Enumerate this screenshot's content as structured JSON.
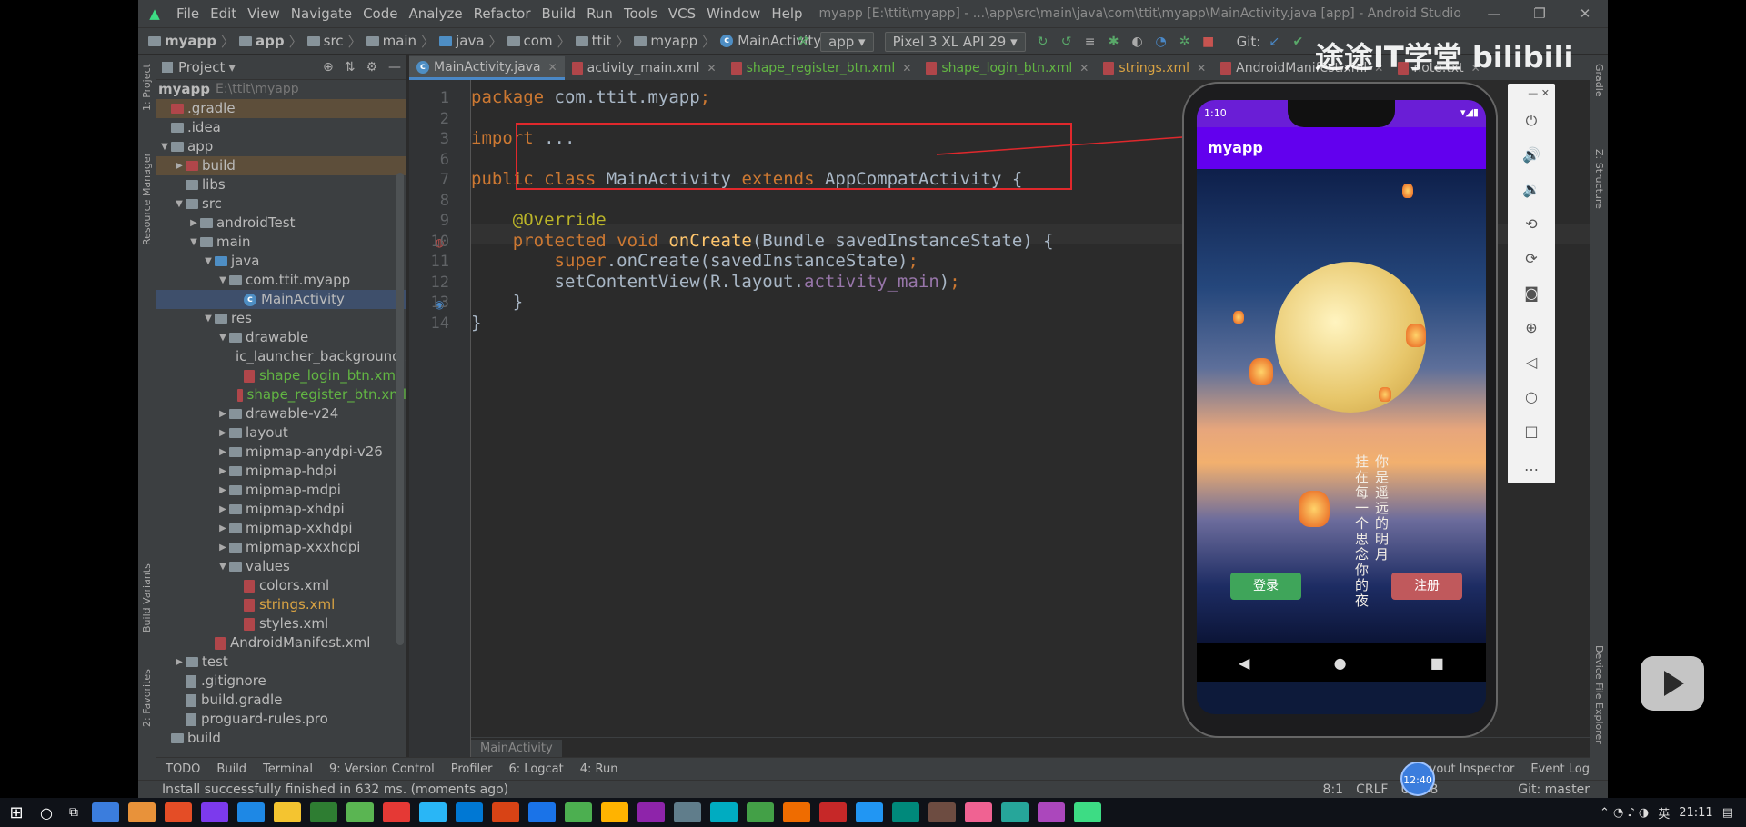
{
  "window": {
    "title": "myapp [E:\\ttit\\myapp] - ...\\app\\src\\main\\java\\com\\ttit\\myapp\\MainActivity.java [app] - Android Studio",
    "menu": [
      "File",
      "Edit",
      "View",
      "Navigate",
      "Code",
      "Analyze",
      "Refactor",
      "Build",
      "Run",
      "Tools",
      "VCS",
      "Window",
      "Help"
    ]
  },
  "breadcrumb": [
    "myapp",
    "app",
    "src",
    "main",
    "java",
    "com",
    "ttit",
    "myapp",
    "MainActivity"
  ],
  "toolbar": {
    "run_config": "app",
    "device": "Pixel 3 XL API 29",
    "git_label": "Git:"
  },
  "project_panel": {
    "header": "Project",
    "root": "myapp",
    "root_path": "E:\\ttit\\myapp",
    "items": [
      {
        "label": ".gradle",
        "indent": 0,
        "type": "folder",
        "state": "excluded"
      },
      {
        "label": ".idea",
        "indent": 0,
        "type": "folder"
      },
      {
        "label": "app",
        "indent": 0,
        "type": "folder",
        "arrow": "open"
      },
      {
        "label": "build",
        "indent": 1,
        "type": "folder",
        "arrow": "closed",
        "state": "excluded"
      },
      {
        "label": "libs",
        "indent": 1,
        "type": "folder"
      },
      {
        "label": "src",
        "indent": 1,
        "type": "folder",
        "arrow": "open"
      },
      {
        "label": "androidTest",
        "indent": 2,
        "type": "folder",
        "arrow": "closed"
      },
      {
        "label": "main",
        "indent": 2,
        "type": "folder",
        "arrow": "open"
      },
      {
        "label": "java",
        "indent": 3,
        "type": "folder-blue",
        "arrow": "open"
      },
      {
        "label": "com.ttit.myapp",
        "indent": 4,
        "type": "folder",
        "arrow": "open"
      },
      {
        "label": "MainActivity",
        "indent": 5,
        "type": "class",
        "state": "selected"
      },
      {
        "label": "res",
        "indent": 3,
        "type": "folder",
        "arrow": "open"
      },
      {
        "label": "drawable",
        "indent": 4,
        "type": "folder",
        "arrow": "open"
      },
      {
        "label": "ic_launcher_background.x",
        "indent": 5,
        "type": "xml"
      },
      {
        "label": "shape_login_btn.xml",
        "indent": 5,
        "type": "xml",
        "color": "#62b543"
      },
      {
        "label": "shape_register_btn.xml",
        "indent": 5,
        "type": "xml",
        "color": "#62b543"
      },
      {
        "label": "drawable-v24",
        "indent": 4,
        "type": "folder",
        "arrow": "closed"
      },
      {
        "label": "layout",
        "indent": 4,
        "type": "folder",
        "arrow": "closed"
      },
      {
        "label": "mipmap-anydpi-v26",
        "indent": 4,
        "type": "folder",
        "arrow": "closed"
      },
      {
        "label": "mipmap-hdpi",
        "indent": 4,
        "type": "folder",
        "arrow": "closed"
      },
      {
        "label": "mipmap-mdpi",
        "indent": 4,
        "type": "folder",
        "arrow": "closed"
      },
      {
        "label": "mipmap-xhdpi",
        "indent": 4,
        "type": "folder",
        "arrow": "closed"
      },
      {
        "label": "mipmap-xxhdpi",
        "indent": 4,
        "type": "folder",
        "arrow": "closed"
      },
      {
        "label": "mipmap-xxxhdpi",
        "indent": 4,
        "type": "folder",
        "arrow": "closed"
      },
      {
        "label": "values",
        "indent": 4,
        "type": "folder",
        "arrow": "open"
      },
      {
        "label": "colors.xml",
        "indent": 5,
        "type": "xml"
      },
      {
        "label": "strings.xml",
        "indent": 5,
        "type": "xml",
        "color": "#d9a343"
      },
      {
        "label": "styles.xml",
        "indent": 5,
        "type": "xml"
      },
      {
        "label": "AndroidManifest.xml",
        "indent": 3,
        "type": "xml"
      },
      {
        "label": "test",
        "indent": 1,
        "type": "folder",
        "arrow": "closed"
      },
      {
        "label": ".gitignore",
        "indent": 1,
        "type": "file"
      },
      {
        "label": "build.gradle",
        "indent": 1,
        "type": "file"
      },
      {
        "label": "proguard-rules.pro",
        "indent": 1,
        "type": "file"
      },
      {
        "label": "build",
        "indent": 0,
        "type": "folder"
      }
    ]
  },
  "tabs": [
    {
      "label": "MainActivity.java",
      "active": true
    },
    {
      "label": "activity_main.xml"
    },
    {
      "label": "shape_register_btn.xml"
    },
    {
      "label": "shape_login_btn.xml"
    },
    {
      "label": "strings.xml"
    },
    {
      "label": "AndroidManifest.xml"
    },
    {
      "label": "note.txt"
    }
  ],
  "code": {
    "line_numbers": [
      "1",
      "2",
      "3",
      "6",
      "7",
      "8",
      "9",
      "10",
      "11",
      "12",
      "13",
      "14"
    ],
    "lines": [
      [
        {
          "t": "package ",
          "c": "kw"
        },
        {
          "t": "com.ttit.myapp",
          "c": "pl"
        },
        {
          "t": ";",
          "c": "kw"
        }
      ],
      [],
      [
        {
          "t": "import ",
          "c": "kw"
        },
        {
          "t": "...",
          "c": "pl"
        }
      ],
      [],
      [
        {
          "t": "public class ",
          "c": "kw"
        },
        {
          "t": "MainActivity ",
          "c": "pl"
        },
        {
          "t": "extends ",
          "c": "kw"
        },
        {
          "t": "AppCompatActivity ",
          "c": "pl"
        },
        {
          "t": "{",
          "c": "pl"
        }
      ],
      [],
      [
        {
          "t": "    @Override",
          "c": "ann"
        }
      ],
      [
        {
          "t": "    protected void ",
          "c": "kw"
        },
        {
          "t": "onCreate",
          "c": "fn"
        },
        {
          "t": "(Bundle savedInstanceState) {",
          "c": "pl"
        }
      ],
      [
        {
          "t": "        super",
          "c": "kw"
        },
        {
          "t": ".onCreate(savedInstanceState)",
          "c": "pl"
        },
        {
          "t": ";",
          "c": "kw"
        }
      ],
      [
        {
          "t": "        setContentView(R.layout.",
          "c": "pl"
        },
        {
          "t": "activity_main",
          "c": "field"
        },
        {
          "t": ")",
          "c": "pl"
        },
        {
          "t": ";",
          "c": "kw"
        }
      ],
      [
        {
          "t": "    }",
          "c": "pl"
        }
      ],
      [
        {
          "t": "}",
          "c": "pl"
        }
      ]
    ],
    "breadcrumb": "MainActivity"
  },
  "tool_windows": [
    "TODO",
    "Build",
    "Terminal",
    "9: Version Control",
    "Profiler",
    "6: Logcat",
    "4: Run"
  ],
  "tool_windows_right": [
    "Layout Inspector",
    "Event Log"
  ],
  "status": {
    "message": "Install successfully finished in 632 ms. (moments ago)",
    "position": "8:1",
    "line_sep": "CRLF",
    "encoding": "UTF-8",
    "git": "Git: master"
  },
  "side_tabs": {
    "left": [
      "1: Project",
      "Resource Manager",
      "Build Variants",
      "2: Favorites"
    ],
    "right": [
      "Gradle",
      "Z: Structure",
      "Device File Explorer"
    ]
  },
  "phone": {
    "time": "1:10",
    "app_title": "myapp",
    "poem_col1": "你是遥远的明月",
    "poem_col2": "挂在每一个思念你的夜",
    "login": "登录",
    "register": "注册"
  },
  "taskbar": {
    "time": "21:11",
    "ime": "英"
  },
  "overlay": {
    "watermark": "途途IT学堂 bilibili",
    "bubble": "12:40"
  }
}
